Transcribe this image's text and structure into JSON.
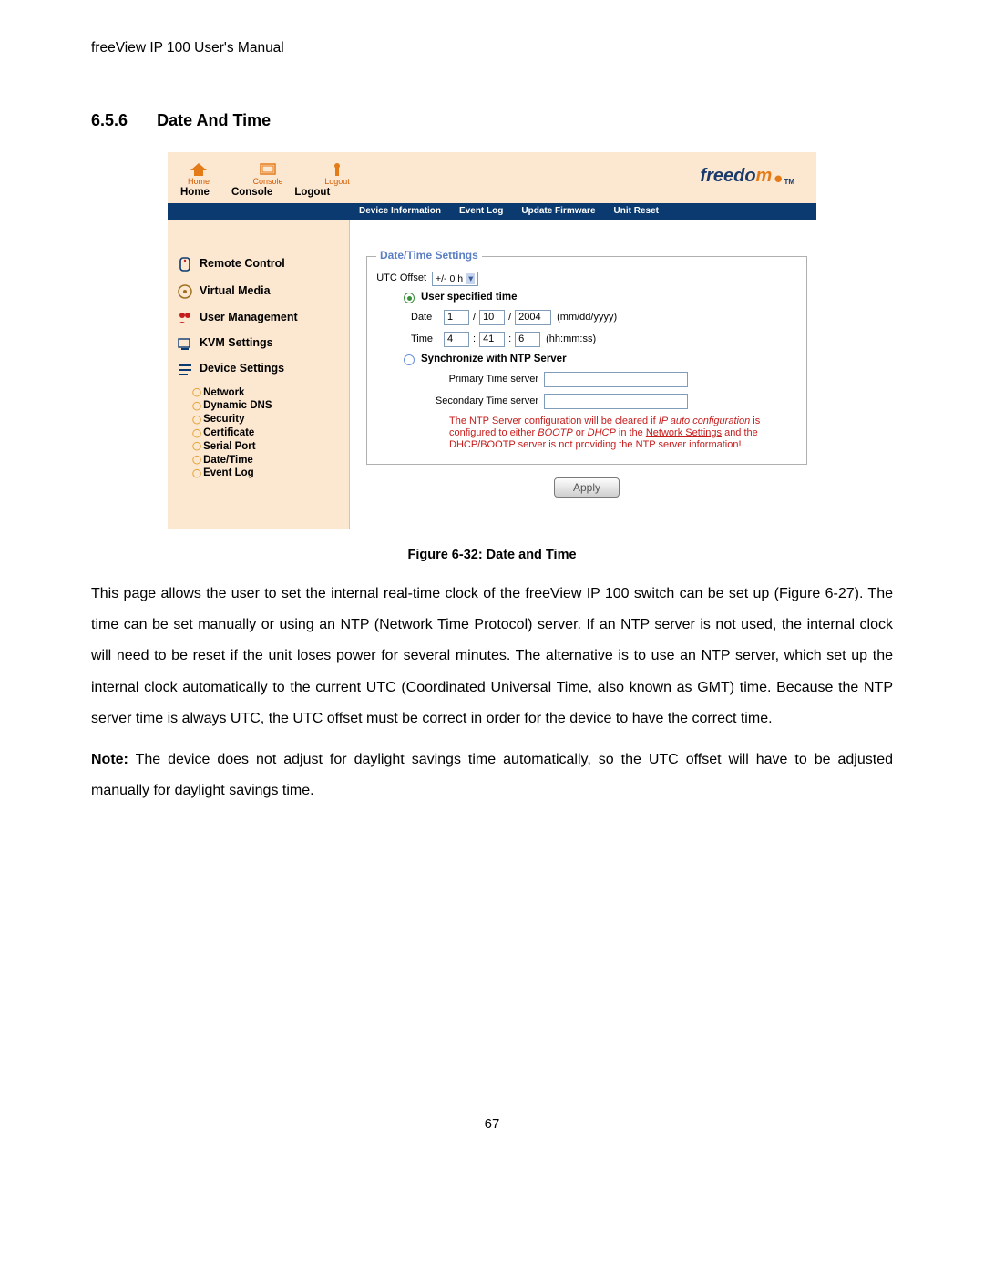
{
  "doc": {
    "header": "freeView IP 100 User's Manual",
    "section_num": "6.5.6",
    "section_title": "Date And Time",
    "page_num": "67",
    "caption": "Figure 6-32: Date and Time"
  },
  "body": {
    "p1": "This page allows the user to set the internal real-time clock of the freeView IP 100 switch can be set up (Figure 6-27). The time can be set manually or using an NTP (Network Time Protocol) server. If an NTP server is not used, the internal clock will need to be reset if the unit loses power for several minutes. The alternative is to use an NTP server, which set up the internal clock automatically to the current UTC (Coordinated Universal Time, also known as GMT) time. Because the NTP server time is always UTC, the UTC offset must be correct in order for the device to have the correct time.",
    "p2_a": "Note:",
    "p2_b": " The device does not adjust for daylight savings time automatically, so the UTC offset will have to be adjusted manually for daylight savings time."
  },
  "ui": {
    "top_icons": {
      "home": "Home",
      "console": "Console",
      "logout": "Logout"
    },
    "top_text": {
      "home": "Home",
      "console": "Console",
      "logout": "Logout"
    },
    "brand": {
      "pre": "freedo",
      "mid": "m",
      "tm": "TM"
    },
    "tabs": {
      "device_info": "Device Information",
      "event_log": "Event Log",
      "update_fw": "Update Firmware",
      "unit_reset": "Unit Reset"
    },
    "sidebar": {
      "remote_control": "Remote Control",
      "virtual_media": "Virtual Media",
      "user_mgmt": "User Management",
      "kvm": "KVM Settings",
      "device": "Device Settings",
      "subs": {
        "network": "Network",
        "ddns": "Dynamic DNS",
        "security": "Security",
        "cert": "Certificate",
        "serial": "Serial Port",
        "datetime": "Date/Time",
        "eventlog": "Event Log"
      }
    },
    "form": {
      "legend": "Date/Time Settings",
      "utc_label": "UTC Offset",
      "utc_selected": "+/- 0 h",
      "radio1": "User specified time",
      "radio2": "Synchronize with NTP Server",
      "date_label": "Date",
      "time_label": "Time",
      "date_mm": "1",
      "date_dd": "10",
      "date_yyyy": "2004",
      "date_hint": "(mm/dd/yyyy)",
      "time_hh": "4",
      "time_mm": "41",
      "time_ss": "6",
      "time_hint": "(hh:mm:ss)",
      "primary": "Primary Time server",
      "secondary": "Secondary Time server",
      "apply": "Apply",
      "warn_a": "The NTP Server configuration will be cleared if ",
      "warn_b": "IP auto configuration",
      "warn_c": " is configured to either ",
      "warn_d": "BOOTP",
      "warn_e": " or ",
      "warn_f": "DHCP",
      "warn_g": " in the ",
      "warn_h": "Network Settings",
      "warn_i": " and the DHCP/BOOTP server is not providing the NTP server information!"
    },
    "slash": "/",
    "colon": ":"
  }
}
